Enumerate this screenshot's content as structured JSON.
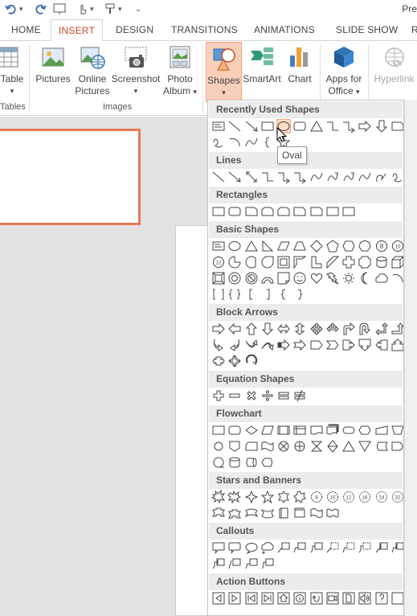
{
  "qat": {
    "doc_title": "Pre"
  },
  "tabs": [
    {
      "label": "HOME",
      "active": false
    },
    {
      "label": "INSERT",
      "active": true
    },
    {
      "label": "DESIGN",
      "active": false
    },
    {
      "label": "TRANSITIONS",
      "active": false
    },
    {
      "label": "ANIMATIONS",
      "active": false
    },
    {
      "label": "SLIDE SHOW",
      "active": false
    },
    {
      "label": "R",
      "active": false
    }
  ],
  "ribbon": {
    "table_label": "Table",
    "pictures_label": "Pictures",
    "online_pictures_line1": "Online",
    "online_pictures_line2": "Pictures",
    "screenshot_label": "Screenshot",
    "photo_album_line1": "Photo",
    "photo_album_line2": "Album",
    "shapes_label": "Shapes",
    "smartart_label": "SmartArt",
    "chart_label": "Chart",
    "apps_line1": "Apps for",
    "apps_line2": "Office",
    "hyperlink_label": "Hyperlink",
    "group_tables": "Tables",
    "group_images": "Images"
  },
  "gallery": {
    "sections": [
      "Recently Used Shapes",
      "Lines",
      "Rectangles",
      "Basic Shapes",
      "Block Arrows",
      "Equation Shapes",
      "Flowchart",
      "Stars and Banners",
      "Callouts",
      "Action Buttons"
    ],
    "tooltip": "Oval",
    "highlighted_shape": "oval"
  },
  "colors": {
    "accent": "#d24726",
    "shapes_hl": "#f9cfb9",
    "thumb_border": "#e97a54"
  }
}
